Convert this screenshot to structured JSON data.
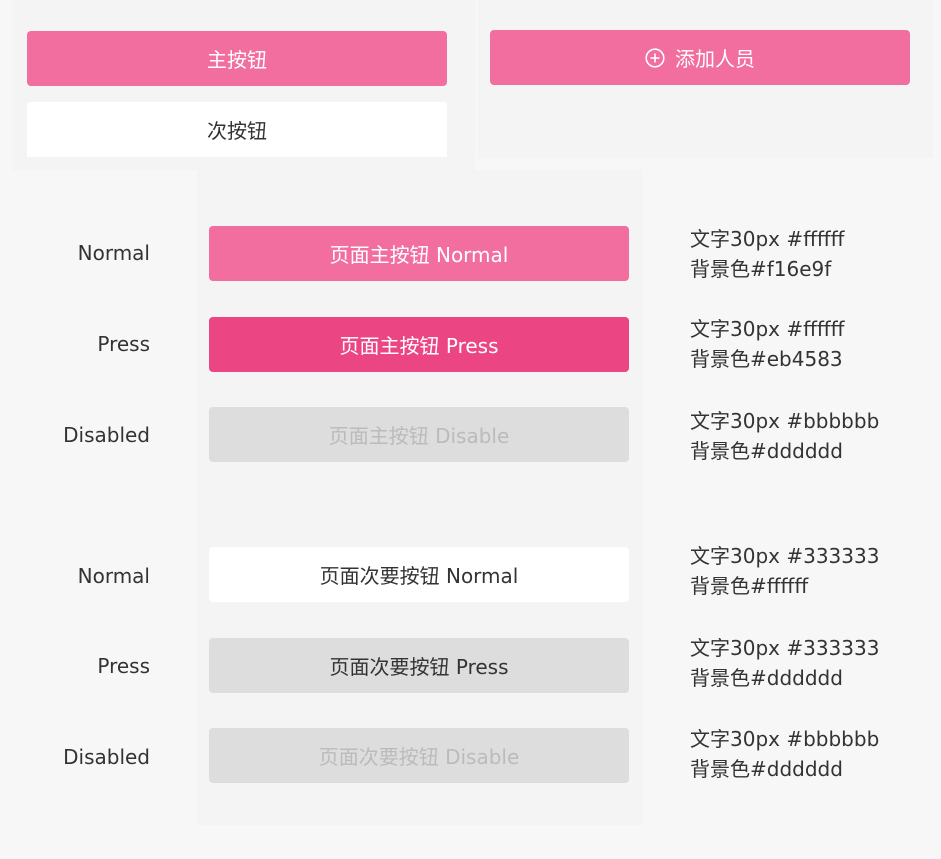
{
  "top": {
    "primary_button": "主按钮",
    "secondary_button": "次按钮",
    "add_person_button": "添加人员",
    "add_person_icon": "plus-circle-icon"
  },
  "rows": [
    {
      "state": "Normal",
      "button": "页面主按钮 Normal",
      "spec_text": "文字30px #ffffff",
      "spec_bg": "背景色#f16e9f"
    },
    {
      "state": "Press",
      "button": "页面主按钮 Press",
      "spec_text": "文字30px #ffffff",
      "spec_bg": "背景色#eb4583"
    },
    {
      "state": "Disabled",
      "button": "页面主按钮 Disable",
      "spec_text": "文字30px #bbbbbb",
      "spec_bg": "背景色#dddddd"
    },
    {
      "state": "Normal",
      "button": "页面次要按钮 Normal",
      "spec_text": "文字30px #333333",
      "spec_bg": "背景色#ffffff"
    },
    {
      "state": "Press",
      "button": "页面次要按钮 Press",
      "spec_text": "文字30px #333333",
      "spec_bg": "背景色#dddddd"
    },
    {
      "state": "Disabled",
      "button": "页面次要按钮 Disable",
      "spec_text": "文字30px #bbbbbb",
      "spec_bg": "背景色#dddddd"
    }
  ],
  "colors": {
    "primary": "#f16e9f",
    "primary_press": "#eb4583",
    "disabled_bg": "#dddddd",
    "disabled_text": "#bbbbbb",
    "secondary_bg": "#ffffff",
    "text_dark": "#333333"
  }
}
